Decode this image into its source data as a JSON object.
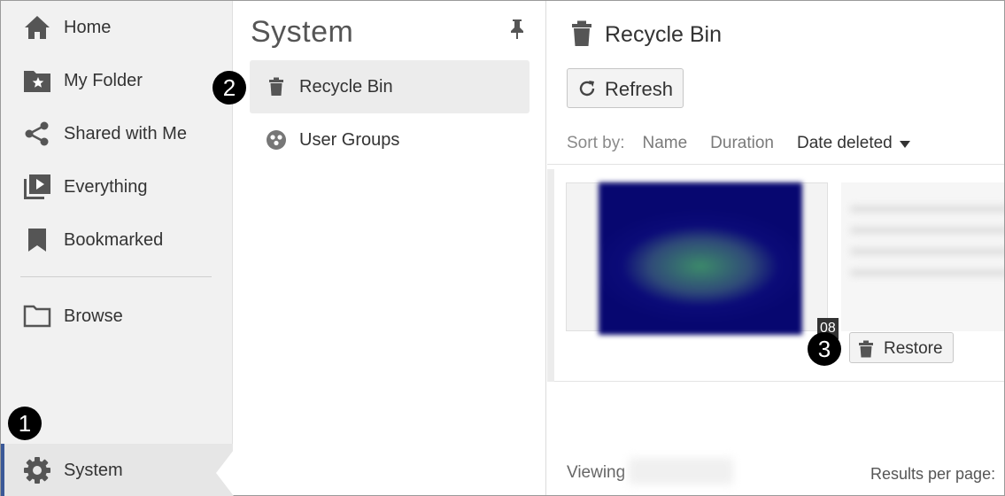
{
  "nav": {
    "items": [
      {
        "label": "Home",
        "icon": "home-icon"
      },
      {
        "label": "My Folder",
        "icon": "folder-star-icon"
      },
      {
        "label": "Shared with Me",
        "icon": "share-icon"
      },
      {
        "label": "Everything",
        "icon": "video-library-icon"
      },
      {
        "label": "Bookmarked",
        "icon": "bookmark-icon"
      },
      {
        "label": "Browse",
        "icon": "folder-outline-icon"
      }
    ],
    "active": {
      "label": "System",
      "icon": "gear-icon"
    }
  },
  "system_panel": {
    "title": "System",
    "items": [
      {
        "label": "Recycle Bin",
        "icon": "trash-icon",
        "selected": true
      },
      {
        "label": "User Groups",
        "icon": "user-groups-icon",
        "selected": false
      }
    ]
  },
  "recycle_bin": {
    "title": "Recycle Bin",
    "refresh_label": "Refresh",
    "sort": {
      "label": "Sort by:",
      "options": [
        "Name",
        "Duration",
        "Date deleted"
      ],
      "active": "Date deleted"
    },
    "items": [
      {
        "duration": "08",
        "restore_label": "Restore"
      }
    ],
    "footer": {
      "viewing": "Viewing",
      "results_per_page": "Results per page:"
    }
  },
  "steps": [
    "1",
    "2",
    "3"
  ],
  "colors": {
    "nav_bg": "#f1f1f1",
    "active_accent": "#3b5998",
    "selected_bg": "#ececec",
    "step_marker": "#000000"
  }
}
